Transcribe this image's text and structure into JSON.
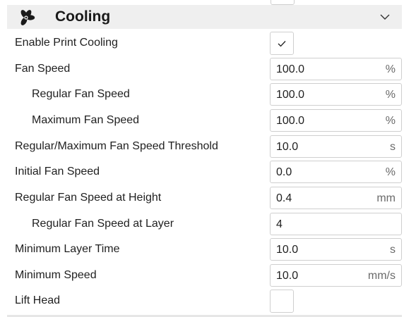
{
  "section": {
    "title": "Cooling",
    "icon": "fan-icon",
    "toggle_icon": "chevron-down-icon"
  },
  "settings": {
    "enable_print_cooling": {
      "label": "Enable Print Cooling",
      "checked": true
    },
    "fan_speed": {
      "label": "Fan Speed",
      "value": "100.0",
      "unit": "%"
    },
    "regular_fan_speed": {
      "label": "Regular Fan Speed",
      "value": "100.0",
      "unit": "%"
    },
    "maximum_fan_speed": {
      "label": "Maximum Fan Speed",
      "value": "100.0",
      "unit": "%"
    },
    "fan_speed_threshold": {
      "label": "Regular/Maximum Fan Speed Threshold",
      "value": "10.0",
      "unit": "s"
    },
    "initial_fan_speed": {
      "label": "Initial Fan Speed",
      "value": "0.0",
      "unit": "%"
    },
    "fan_speed_at_height": {
      "label": "Regular Fan Speed at Height",
      "value": "0.4",
      "unit": "mm"
    },
    "fan_speed_at_layer": {
      "label": "Regular Fan Speed at Layer",
      "value": "4",
      "unit": ""
    },
    "minimum_layer_time": {
      "label": "Minimum Layer Time",
      "value": "10.0",
      "unit": "s"
    },
    "minimum_speed": {
      "label": "Minimum Speed",
      "value": "10.0",
      "unit": "mm/s"
    },
    "lift_head": {
      "label": "Lift Head",
      "checked": false
    }
  }
}
